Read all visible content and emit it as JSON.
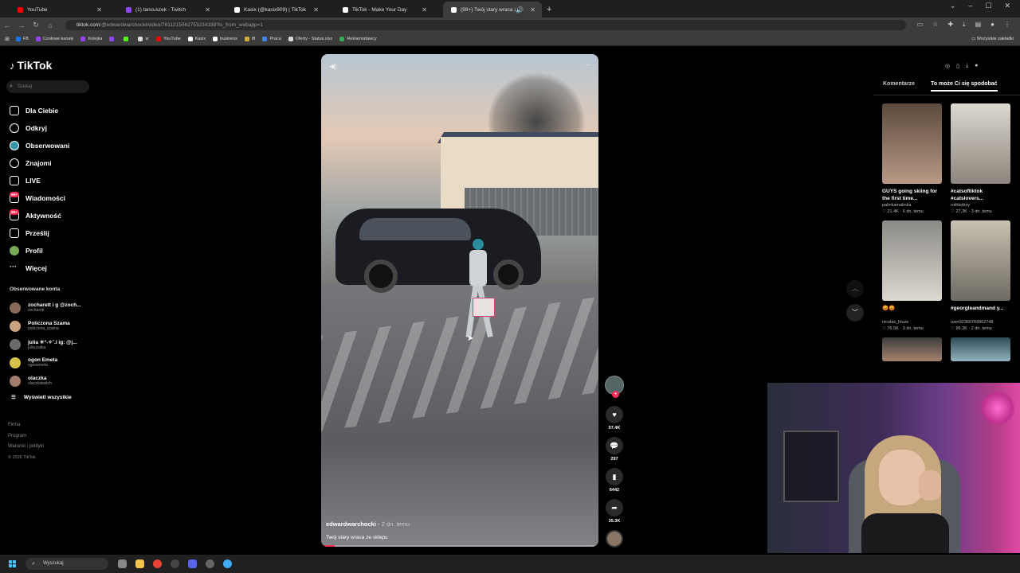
{
  "browser": {
    "tabs": [
      {
        "title": "YouTube",
        "color": "#ff0000",
        "active": false
      },
      {
        "title": "(1) tancuszek - Twitch",
        "color": "#9146ff",
        "active": false
      },
      {
        "title": "Kasix (@kasix909) | TikTok",
        "color": "#ffffff",
        "active": false
      },
      {
        "title": "TikTok - Make Your Day",
        "color": "#ffffff",
        "active": false
      },
      {
        "title": "(99+) Twój stary wraca ze sk...",
        "color": "#ffffff",
        "active": true
      }
    ],
    "url_host": "tiktok.com",
    "url_path": "/@edwardwarchocki/video/7611215062753234198?is_from_webapp=1",
    "bookmarks": [
      {
        "label": "FB",
        "color": "#1877f2"
      },
      {
        "label": "Czołowe kanały",
        "color": "#9146ff"
      },
      {
        "label": "Kolejka",
        "color": "#9146ff"
      },
      {
        "label": "",
        "color": "#9146ff"
      },
      {
        "label": "",
        "color": "#53fc18"
      },
      {
        "label": "sr",
        "color": "#dddddd"
      },
      {
        "label": "YouTube",
        "color": "#ff0000"
      },
      {
        "label": "Kasix",
        "color": "#ffffff"
      },
      {
        "label": "business",
        "color": "#ffffff"
      },
      {
        "label": "tft",
        "color": "#d4af37"
      },
      {
        "label": "Praca",
        "color": "#4285f4"
      },
      {
        "label": "Oferty - Status.xlsx",
        "color": "#dddddd"
      },
      {
        "label": "Reklamodawcy",
        "color": "#34a853"
      }
    ],
    "bookmarks_all": "Wszystkie zakładki"
  },
  "tiktok": {
    "logo": "TikTok",
    "search_placeholder": "Szukaj",
    "nav": [
      {
        "label": "Dla Ciebie",
        "icon": "home-icon"
      },
      {
        "label": "Odkryj",
        "icon": "compass-icon"
      },
      {
        "label": "Obserwowani",
        "icon": "following-icon"
      },
      {
        "label": "Znajomi",
        "icon": "friends-icon"
      },
      {
        "label": "LIVE",
        "icon": "live-icon"
      },
      {
        "label": "Wiadomości",
        "icon": "messages-icon",
        "badge": "99+"
      },
      {
        "label": "Aktywność",
        "icon": "activity-icon",
        "badge": "99+"
      },
      {
        "label": "Prześlij",
        "icon": "upload-icon"
      },
      {
        "label": "Profil",
        "icon": "profile-avatar"
      },
      {
        "label": "Więcej",
        "icon": "more-icon"
      }
    ],
    "followed_header": "Obserwowane konta",
    "followed": [
      {
        "name": "zocharett i g @zoch...",
        "handle": "zocharett",
        "color": "#8a6b5a"
      },
      {
        "name": "Policzona Szama",
        "handle": "policzona_szama",
        "color": "#c9a27f"
      },
      {
        "name": "julia ☀︎°˖✧˚.i ig: @j...",
        "handle": "julia.palka",
        "color": "#6b6b6b"
      },
      {
        "name": "ogon Emeta",
        "handle": "ogonemeta",
        "color": "#d6c24a"
      },
      {
        "name": "olaczka",
        "handle": "olaczkatwitch",
        "color": "#a37b6b"
      }
    ],
    "show_all": "Wyświetl wszystkie",
    "footer": [
      "Firma",
      "Program",
      "Warunki i polityki"
    ],
    "copyright": "© 2026 TikTok"
  },
  "video": {
    "author": "edwardwarchocki",
    "date": "2 dn. temu",
    "description": "Twój stary wraca ze sklepu",
    "progress": 0.05,
    "likes": "57.4K",
    "comments": "297",
    "saves": "6442",
    "shares": "35.3K"
  },
  "right_panel": {
    "tabs": [
      "Komentarze",
      "To może Ci się spodobać"
    ],
    "active_tab": 1,
    "cards": [
      {
        "title": "GUYS going skiing for the first time...",
        "user": "palinkamalinka",
        "likes": "21.4K",
        "date": "6 dn. temu",
        "color": "#8a7466"
      },
      {
        "title": "#catsoftiktok #catslovers...",
        "user": "rothkoboy",
        "likes": "27.3K",
        "date": "3 dn. temu",
        "color": "#a8a39c"
      },
      {
        "title": "😡😡",
        "user": "nicolas_hluze",
        "likes": "76.5K",
        "date": "3 dn. temu",
        "color": "#6e6c68"
      },
      {
        "title": "#georgleandmand y...",
        "user": "user92360769962748",
        "likes": "95.2K",
        "date": "2 dn. temu",
        "color": "#b9b4a8"
      },
      {
        "title": "",
        "user": "",
        "likes": "",
        "date": "",
        "color": "#7a5a4c"
      },
      {
        "title": "",
        "user": "",
        "likes": "",
        "date": "",
        "color": "#5c7e8a"
      }
    ]
  },
  "taskbar": {
    "search_placeholder": "Wyszukaj",
    "icons": [
      {
        "name": "task-view-icon",
        "color": "#888888"
      },
      {
        "name": "file-explorer-icon",
        "color": "#f2c14e"
      },
      {
        "name": "chrome-icon",
        "color": "#e94335"
      },
      {
        "name": "obs-icon",
        "color": "#444444"
      },
      {
        "name": "discord-icon",
        "color": "#5865f2"
      },
      {
        "name": "media-player-icon",
        "color": "#666666"
      },
      {
        "name": "browser-icon",
        "color": "#3fa9f5"
      }
    ]
  }
}
